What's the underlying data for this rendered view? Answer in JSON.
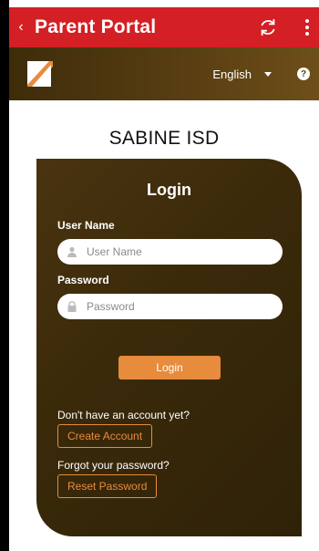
{
  "header": {
    "back_label": "‹",
    "title": "Parent Portal",
    "refresh_icon": "refresh-icon",
    "menu_icon": "more-vertical-icon",
    "bar_color": "#d41f24"
  },
  "brand": {
    "logo_icon": "app-logo-icon",
    "language": "English",
    "help_icon": "help-icon"
  },
  "district": "SABINE ISD",
  "login": {
    "title": "Login",
    "username_label": "User Name",
    "username_placeholder": "User Name",
    "username_value": "",
    "password_label": "Password",
    "password_placeholder": "Password",
    "password_value": "",
    "submit_label": "Login"
  },
  "account": {
    "no_account_text": "Don't have an account yet?",
    "create_label": "Create Account",
    "forgot_text": "Forgot your password?",
    "reset_label": "Reset Password"
  },
  "colors": {
    "accent": "#e78b3c",
    "card_brown": "#3b2a0a"
  }
}
